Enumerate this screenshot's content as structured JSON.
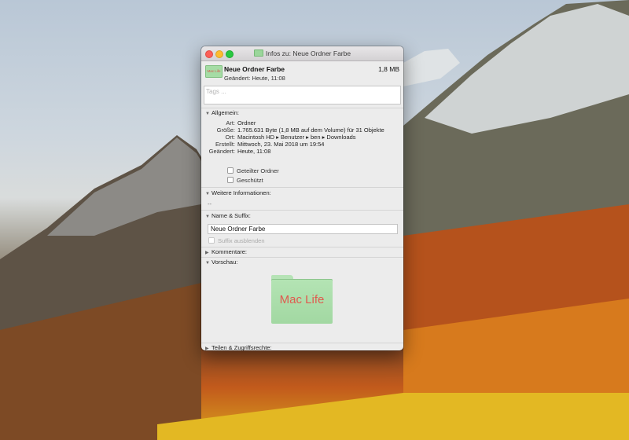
{
  "window": {
    "title": "Infos zu: Neue Ordner Farbe"
  },
  "header": {
    "icon_text": "Mac Life",
    "name": "Neue Ordner Farbe",
    "size": "1,8 MB",
    "modified": "Geändert: Heute, 11:08"
  },
  "tags": {
    "placeholder": "Tags ..."
  },
  "general": {
    "title": "Allgemein:",
    "rows": [
      {
        "k": "Art:",
        "v": "Ordner"
      },
      {
        "k": "Größe:",
        "v": "1.765.631 Byte (1,8 MB auf dem Volume) für 31 Objekte"
      },
      {
        "k": "Ort:",
        "v": "Macintosh HD ▸ Benutzer ▸ ben ▸ Downloads"
      },
      {
        "k": "Erstellt:",
        "v": "Mittwoch, 23. Mai 2018 um 19:54"
      },
      {
        "k": "Geändert:",
        "v": "Heute, 11:08"
      }
    ],
    "shared_label": "Geteilter Ordner",
    "locked_label": "Geschützt"
  },
  "more_info": {
    "title": "Weitere Informationen:",
    "value": "--"
  },
  "name_suffix": {
    "title": "Name & Suffix:",
    "value": "Neue Ordner Farbe",
    "hide_suffix_label": "Suffix ausblenden"
  },
  "comments": {
    "title": "Kommentare:"
  },
  "preview": {
    "title": "Vorschau:",
    "folder_text": "Mac Life"
  },
  "sharing": {
    "title": "Teilen & Zugriffsrechte:"
  },
  "colors": {
    "folder_green": "#a5dca5",
    "folder_text_red": "#e05a4f"
  }
}
